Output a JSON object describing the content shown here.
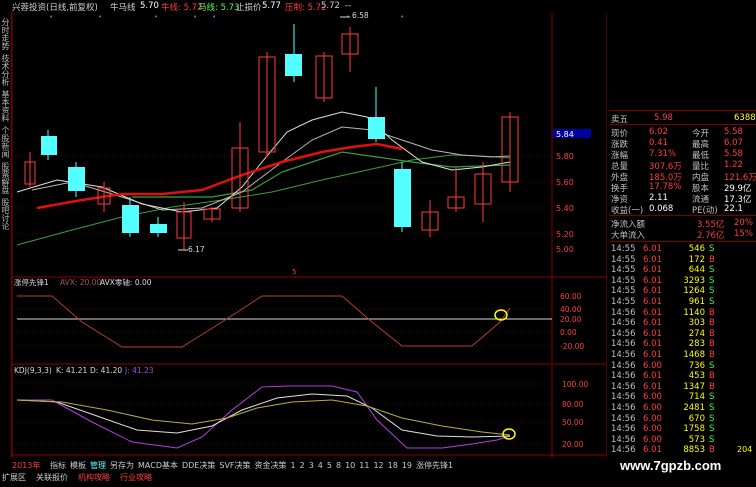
{
  "title": {
    "main": "兴蓉投资(日线,前复权)",
    "niu_label": "牛马线",
    "niu_value": "5.70",
    "niuxian": "牛线: 5.72",
    "maxian": "马线: 5.73",
    "stop_label": "止损价",
    "stop_value": "5.77",
    "yazhi": "压制: 5.72",
    "yazhi2": "5.72",
    "dash": "--"
  },
  "side_tabs": [
    "分时走势",
    "技术分析",
    "基本资料",
    "个股新闻",
    "股票解盘",
    "股吧讨论"
  ],
  "price_chart": {
    "high_label": "6.58",
    "low_label": "6.17",
    "mid_marker": "5",
    "right_axis": [
      "5.84",
      "5.80",
      "5.60",
      "5.40",
      "5.20",
      "5.00"
    ]
  },
  "indicator1": {
    "title": "涨停先锋1",
    "avx": "AVX: 20.00",
    "zero_label": "AVX零轴: 0.00",
    "axis": [
      "60.00",
      "40.00",
      "20.00",
      "0.00",
      "-20.00"
    ]
  },
  "kdj": {
    "title": "KDJ(9,3,3)",
    "k": "K: 41.21",
    "d": "D: 41.20",
    "j": "J: 41.23",
    "axis": [
      "100.00",
      "80.00",
      "50.00",
      "20.00"
    ]
  },
  "quote": {
    "sell5_label": "卖五",
    "sell5_price": "5.98",
    "sell5_vol": "6388",
    "current_tag": "5.84",
    "rows": [
      {
        "l1": "现价",
        "v1": "6.02",
        "l2": "今开",
        "v2": "5.58"
      },
      {
        "l1": "涨跌",
        "v1": "0.41",
        "l2": "最高",
        "v2": "6.07"
      },
      {
        "l1": "涨幅",
        "v1": "7.31%",
        "l2": "最低",
        "v2": "5.58"
      },
      {
        "l1": "总量",
        "v1": "307.6万",
        "l2": "量比",
        "v2": "1.22"
      },
      {
        "l1": "外盘",
        "v1": "185.0万",
        "l2": "内盘",
        "v2": "121.6万"
      },
      {
        "l1": "换手",
        "v1": "17.78%",
        "l2": "股本",
        "v2": "29.9亿"
      },
      {
        "l1": "净资",
        "v1": "2.11",
        "l2": "流通",
        "v2": "17.3亿"
      },
      {
        "l1": "收益(一)",
        "v1": "0.068",
        "l2": "PE(动)",
        "v2": "22.1"
      }
    ],
    "flow": [
      {
        "label": "净流入额",
        "v1": "3.55亿",
        "v2": "20%"
      },
      {
        "label": "大单流入",
        "v1": "2.76亿",
        "v2": "15%"
      }
    ],
    "ticks": [
      {
        "t": "14:55",
        "p": "6.01",
        "v": "546",
        "s": "S"
      },
      {
        "t": "14:55",
        "p": "6.01",
        "v": "172",
        "s": "B"
      },
      {
        "t": "14:55",
        "p": "6.01",
        "v": "644",
        "s": "S"
      },
      {
        "t": "14:55",
        "p": "6.01",
        "v": "3293",
        "s": "S"
      },
      {
        "t": "14:55",
        "p": "6.01",
        "v": "1264",
        "s": "S"
      },
      {
        "t": "14:55",
        "p": "6.01",
        "v": "961",
        "s": "S"
      },
      {
        "t": "14:56",
        "p": "6.01",
        "v": "1140",
        "s": "B"
      },
      {
        "t": "14:56",
        "p": "6.01",
        "v": "303",
        "s": "B"
      },
      {
        "t": "14:56",
        "p": "6.01",
        "v": "274",
        "s": "B"
      },
      {
        "t": "14:56",
        "p": "6.01",
        "v": "283",
        "s": "B"
      },
      {
        "t": "14:56",
        "p": "6.01",
        "v": "1468",
        "s": "B"
      },
      {
        "t": "14:56",
        "p": "6.00",
        "v": "736",
        "s": "S"
      },
      {
        "t": "14:56",
        "p": "6.01",
        "v": "453",
        "s": "B"
      },
      {
        "t": "14:56",
        "p": "6.01",
        "v": "1347",
        "s": "B"
      },
      {
        "t": "14:56",
        "p": "6.00",
        "v": "714",
        "s": "S"
      },
      {
        "t": "14:56",
        "p": "6.00",
        "v": "2481",
        "s": "S"
      },
      {
        "t": "14:56",
        "p": "6.00",
        "v": "670",
        "s": "S"
      },
      {
        "t": "14:56",
        "p": "6.00",
        "v": "1758",
        "s": "S"
      },
      {
        "t": "14:56",
        "p": "6.00",
        "v": "573",
        "s": "S"
      },
      {
        "t": "14:56",
        "p": "6.01",
        "v": "8853",
        "s": "B"
      }
    ],
    "tick_tail": "204"
  },
  "bottom": {
    "year": "2013年",
    "scroll_marker": "5",
    "tabs1": [
      "指标",
      "模板",
      "管理",
      "另存为",
      "MACD基本",
      "DDE决策",
      "SVF决策",
      "资金决策",
      "1",
      "2",
      "3",
      "4",
      "5",
      "8",
      "10",
      "11",
      "12",
      "18",
      "19",
      "涨停先锋1"
    ],
    "tabs2": [
      "扩展区",
      "关联报价",
      "机构攻略",
      "行业攻略"
    ]
  },
  "watermark": "www.7gpzb.com",
  "colors": {
    "up": "#ff3c3c",
    "down": "#54ffff",
    "ma_white": "#d8d8d8",
    "ma_red": "#e01010",
    "ma_green": "#39a03a",
    "kdj_j": "#b040e0",
    "axis_red": "#8a0000",
    "highlight": "#ffff00"
  }
}
